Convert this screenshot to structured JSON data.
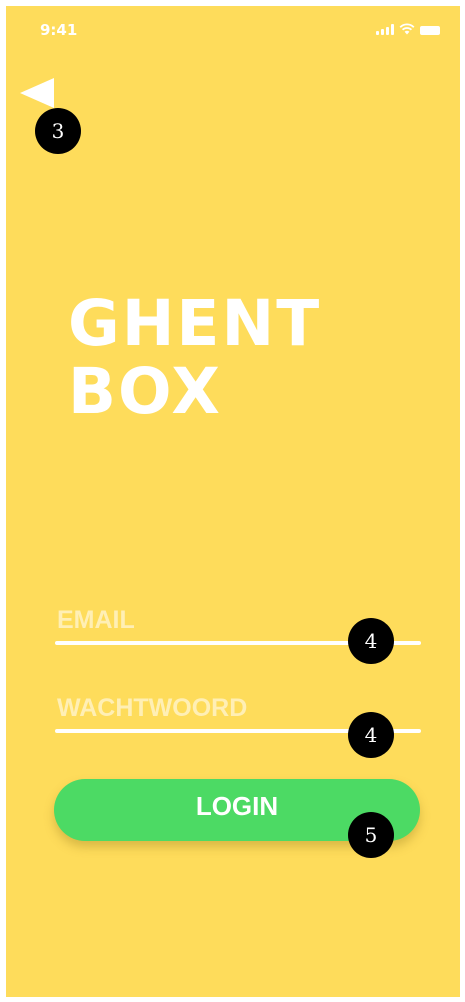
{
  "status_bar": {
    "time": "9:41"
  },
  "title": {
    "line1": "GHENT",
    "line2": "BOX"
  },
  "form": {
    "email_placeholder": "EMAIL",
    "password_placeholder": "WACHTWOORD",
    "login_label": "LOGIN"
  },
  "annotations": {
    "back": "3",
    "email": "4",
    "password": "4",
    "login": "5"
  },
  "colors": {
    "background": "#FEDC5B",
    "button": "#4CDA64",
    "text": "#FFFFFF"
  },
  "icons": {
    "back": "back-arrow-icon",
    "signal": "signal-icon",
    "wifi": "wifi-icon",
    "battery": "battery-icon"
  }
}
